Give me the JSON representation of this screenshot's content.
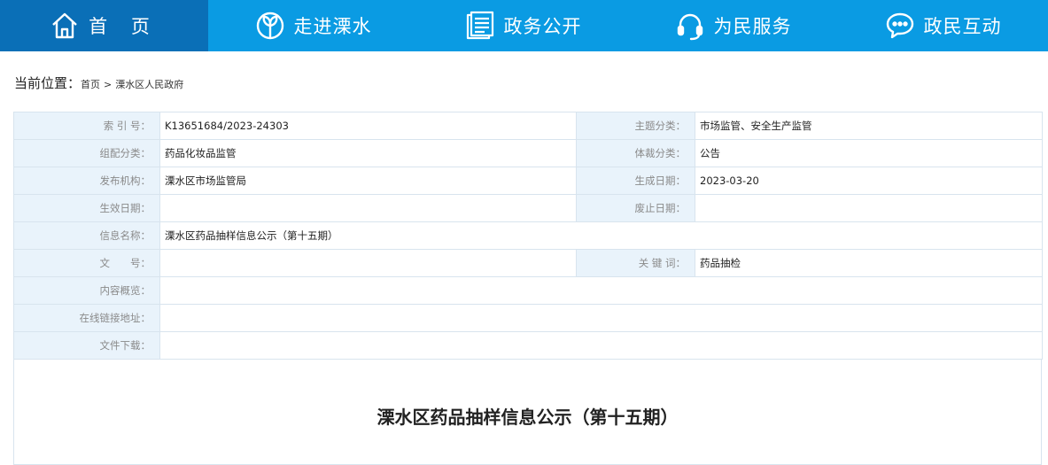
{
  "nav": {
    "items": [
      {
        "label": "首 页",
        "icon": "home-icon"
      },
      {
        "label": "走进溧水",
        "icon": "sprout-icon"
      },
      {
        "label": "政务公开",
        "icon": "document-icon"
      },
      {
        "label": "为民服务",
        "icon": "headset-icon"
      },
      {
        "label": "政民互动",
        "icon": "chat-icon"
      }
    ],
    "colors": {
      "bar": "#0a9be3",
      "active": "#0a6fb7"
    }
  },
  "breadcrumb": {
    "current_label": "当前位置：",
    "home": "首页",
    "separator": ">",
    "last": "溧水区人民政府"
  },
  "info": {
    "index_label": "索 引 号：",
    "index_value": "K13651684/2023-24303",
    "topic_label": "主题分类：",
    "topic_value": "市场监管、安全生产监管",
    "org_category_label": "组配分类：",
    "org_category_value": "药品化妆品监管",
    "genre_label": "体裁分类：",
    "genre_value": "公告",
    "publisher_label": "发布机构：",
    "publisher_value": "溧水区市场监管局",
    "created_label": "生成日期：",
    "created_value": "2023-03-20",
    "effective_label": "生效日期：",
    "effective_value": "",
    "expire_label": "废止日期：",
    "expire_value": "",
    "name_label": "信息名称：",
    "name_value": "溧水区药品抽样信息公示（第十五期）",
    "docno_label": "文　　号：",
    "docno_value": "",
    "keywords_label": "关 键 词：",
    "keywords_value": "药品抽检",
    "summary_label": "内容概览：",
    "summary_value": "",
    "link_label": "在线链接地址：",
    "link_value": "",
    "download_label": "文件下载：",
    "download_value": ""
  },
  "article": {
    "title": "溧水区药品抽样信息公示（第十五期）"
  }
}
